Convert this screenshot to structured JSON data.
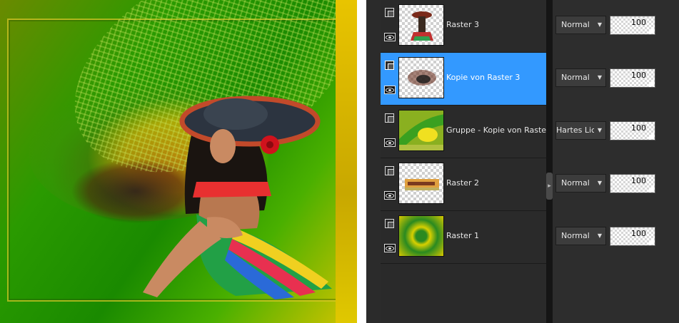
{
  "canvas": {
    "description_colors": {
      "green": "#1a8a00",
      "yellow": "#f4e400"
    }
  },
  "layers": [
    {
      "name": "Raster 3",
      "blend_mode": "Normal",
      "opacity": "100",
      "selected": false
    },
    {
      "name": "Kopie von Raster 3",
      "blend_mode": "Normal",
      "opacity": "100",
      "selected": true
    },
    {
      "name": "Gruppe - Kopie von Raster",
      "blend_mode": "Hartes Licht",
      "opacity": "100",
      "selected": false
    },
    {
      "name": "Raster 2",
      "blend_mode": "Normal",
      "opacity": "100",
      "selected": false
    },
    {
      "name": "Raster 1",
      "blend_mode": "Normal",
      "opacity": "100",
      "selected": false
    }
  ],
  "icons": {
    "lock": "lock-icon",
    "visibility": "eye-icon",
    "dropdown": "chevron-down-icon",
    "splitter": "chevron-right-icon"
  },
  "colors": {
    "selection": "#3399ff",
    "panel": "#2a2a2a"
  }
}
